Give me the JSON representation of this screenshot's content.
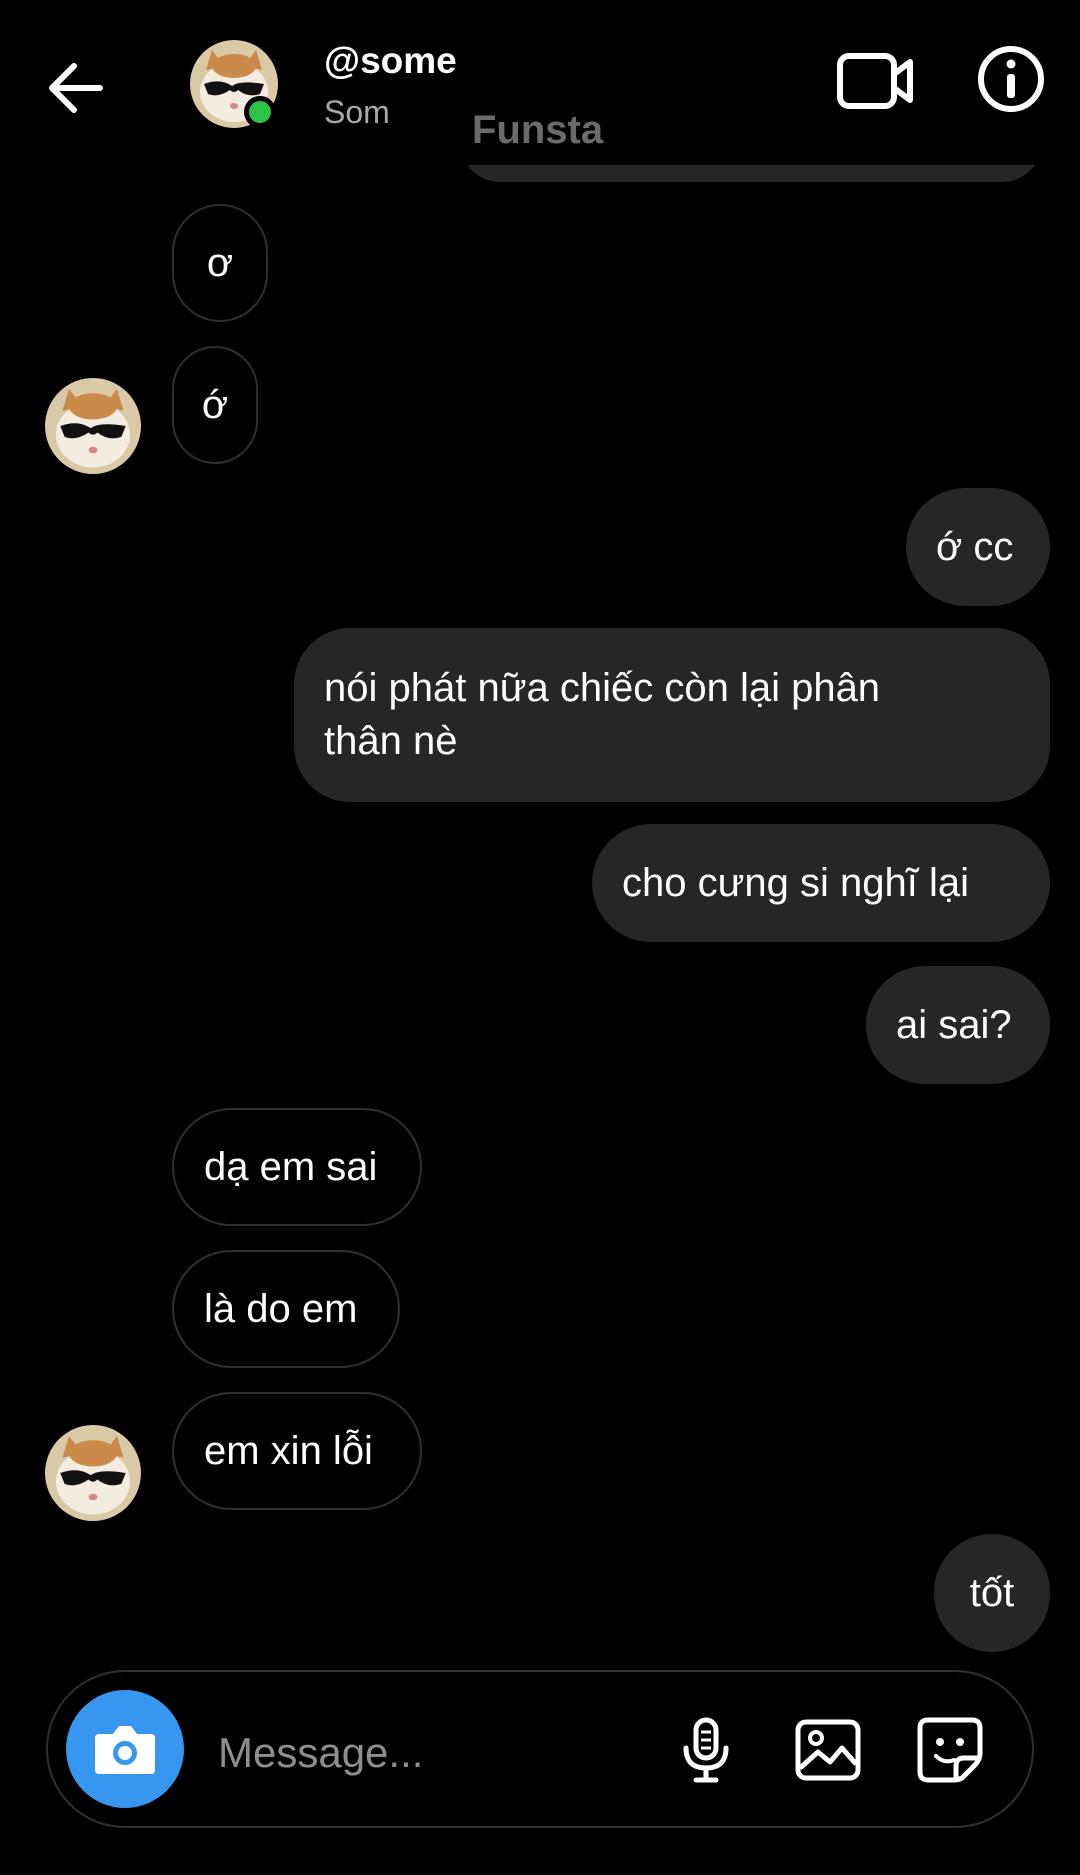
{
  "header": {
    "username": "@some",
    "status": "Som"
  },
  "previous_message": {
    "text": "Funsta"
  },
  "messages": [
    {
      "text": "ơ"
    },
    {
      "text": "ớ"
    },
    {
      "text": "ớ cc"
    },
    {
      "text": "nói phát nữa chiếc còn lại phân thân nè"
    },
    {
      "text": "cho cưng si nghĩ lại"
    },
    {
      "text": "ai sai?"
    },
    {
      "text": "dạ em sai"
    },
    {
      "text": "là do em"
    },
    {
      "text": "em xin lỗi"
    },
    {
      "text": "tốt"
    }
  ],
  "composer": {
    "placeholder": "Message..."
  },
  "colors": {
    "background": "#000000",
    "outgoing_bubble": "#262626",
    "incoming_border": "#2f2f2f",
    "accent_blue": "#3797f0",
    "online_green": "#2bc448"
  },
  "icons": [
    "back-arrow-icon",
    "video-call-icon",
    "info-icon",
    "camera-icon",
    "microphone-icon",
    "gallery-icon",
    "sticker-icon"
  ]
}
